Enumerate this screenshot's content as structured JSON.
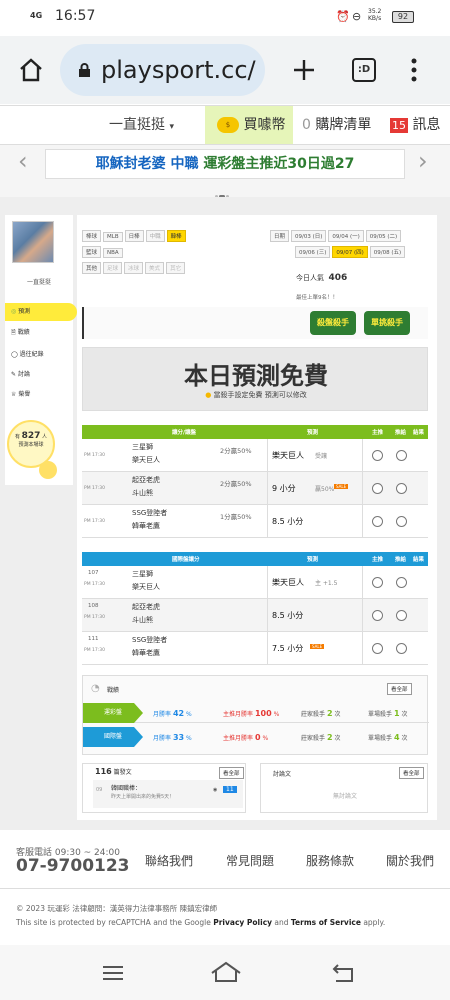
{
  "status": {
    "signal": "4G",
    "time": "16:57",
    "speed": "35.2\nKB/s",
    "battery": "92"
  },
  "browser": {
    "url": "playsport.cc/",
    "tabs_label": ":D"
  },
  "topnav": {
    "menu": "一直挺挺",
    "buy_coin": "買噱幣",
    "cart_count": "0",
    "cart": "購牌清單",
    "msg_count": "15",
    "messages": "訊息"
  },
  "banner": {
    "prefix": "耶穌封老婆",
    "middle": " 中職 ",
    "highlight": "運彩盤主推近30日過27"
  },
  "profile": {
    "name": "一直挺挺",
    "count": "827",
    "count_prefix": "有",
    "count_suffix": "人",
    "count_line2": "預測本場球"
  },
  "sidebar": {
    "items": [
      "預測",
      "戰績",
      "過往紀錄",
      "討論",
      "榮譽"
    ]
  },
  "filters": {
    "sport_label": "棒球",
    "sports": [
      "MLB",
      "日棒",
      "中職",
      "韓棒"
    ],
    "bball_label": "籃球",
    "bball": [
      "NBA"
    ],
    "other_label": "其他",
    "others": [
      "足球",
      "冰球",
      "美式",
      "其它"
    ],
    "date_label": "日期",
    "dates": [
      "09/03 (日)",
      "09/04 (一)",
      "09/05 (二)",
      "09/06 (三)",
      "09/07 (四)",
      "09/08 (五)"
    ]
  },
  "today": {
    "label": "今日人氣",
    "value": "406",
    "sub": "最佳上單9名！！"
  },
  "badges": [
    "殺盤殺手",
    "單挑殺手"
  ],
  "promo": {
    "title": "本日預測免費",
    "sub": "當殺手設定免費 預測可以修改"
  },
  "table1": {
    "headers": [
      "讓分/讓盤",
      "預測",
      "主推",
      "推給",
      "結果"
    ],
    "rows": [
      {
        "time": "PM 17:30",
        "team1": "三星獅",
        "team2": "樂天巨人",
        "spread": "2分贏50%",
        "pick": "樂天巨人",
        "note": "受讓"
      },
      {
        "time": "PM 17:30",
        "team1": "起亞老虎",
        "team2": "斗山熊",
        "spread": "2分贏50%",
        "pick": "9 小分",
        "note": "贏50%",
        "tag": "SALE"
      },
      {
        "time": "PM 17:30",
        "team1": "SSG登陸者",
        "team2": "韓華老鷹",
        "spread": "1分贏50%",
        "pick": "8.5 小分",
        "note": ""
      }
    ]
  },
  "table2": {
    "headers": [
      "國際盤讓分",
      "預測",
      "主推",
      "推給",
      "結果"
    ],
    "rows": [
      {
        "num": "107",
        "time": "PM 17:30",
        "team1": "三星獅",
        "team2": "樂天巨人",
        "pick": "樂天巨人",
        "note": "主 +1.5"
      },
      {
        "num": "108",
        "time": "PM 17:30",
        "team1": "起亞老虎",
        "team2": "斗山熊",
        "pick": "8.5 小分",
        "note": ""
      },
      {
        "num": "111",
        "time": "PM 17:30",
        "team1": "SSG登陸者",
        "team2": "韓華老鷹",
        "pick": "7.5 小分",
        "note": "",
        "tag": "SALE"
      }
    ]
  },
  "record": {
    "title": "戰績",
    "more": "看全部",
    "rows": [
      {
        "label": "運彩盤",
        "rate_label": "月勝率",
        "rate": "42",
        "pct": "%",
        "main_label": "主推月勝率",
        "main": "100",
        "kill_label": "莊家殺手",
        "kill": "2",
        "kill_unit": "次",
        "single_label": "單場殺手",
        "single": "1",
        "single_unit": "次"
      },
      {
        "label": "國際盤",
        "rate_label": "月勝率",
        "rate": "33",
        "pct": "%",
        "main_label": "主推月勝率",
        "main": "0",
        "kill_label": "莊家殺手",
        "kill": "2",
        "kill_unit": "次",
        "single_label": "單場殺手",
        "single": "4",
        "single_unit": "次"
      }
    ]
  },
  "posts": {
    "count": "116",
    "label": "篇發文",
    "more": "看全部",
    "date": "09",
    "post_title": "韓國職棒：",
    "post_sub": "昨天上單開出來的免費5天！",
    "views": "11"
  },
  "discuss": {
    "title": "討論文",
    "more": "看全部",
    "empty": "無討論文"
  },
  "footer": {
    "service_label": "客服電話 09:30 ~ 24:00",
    "phone": "07-9700123",
    "links": [
      "聯絡我們",
      "常見問題",
      "服務條款",
      "關於我們"
    ],
    "copyright": "© 2023 玩運彩 法律顧問：漢英得力法律事務所 陳鎮宏律師",
    "recaptcha1": "This site is protected by reCAPTCHA and the Google ",
    "privacy": "Privacy Policy",
    "and": " and ",
    "terms": "Terms of Service",
    "apply": " apply."
  }
}
